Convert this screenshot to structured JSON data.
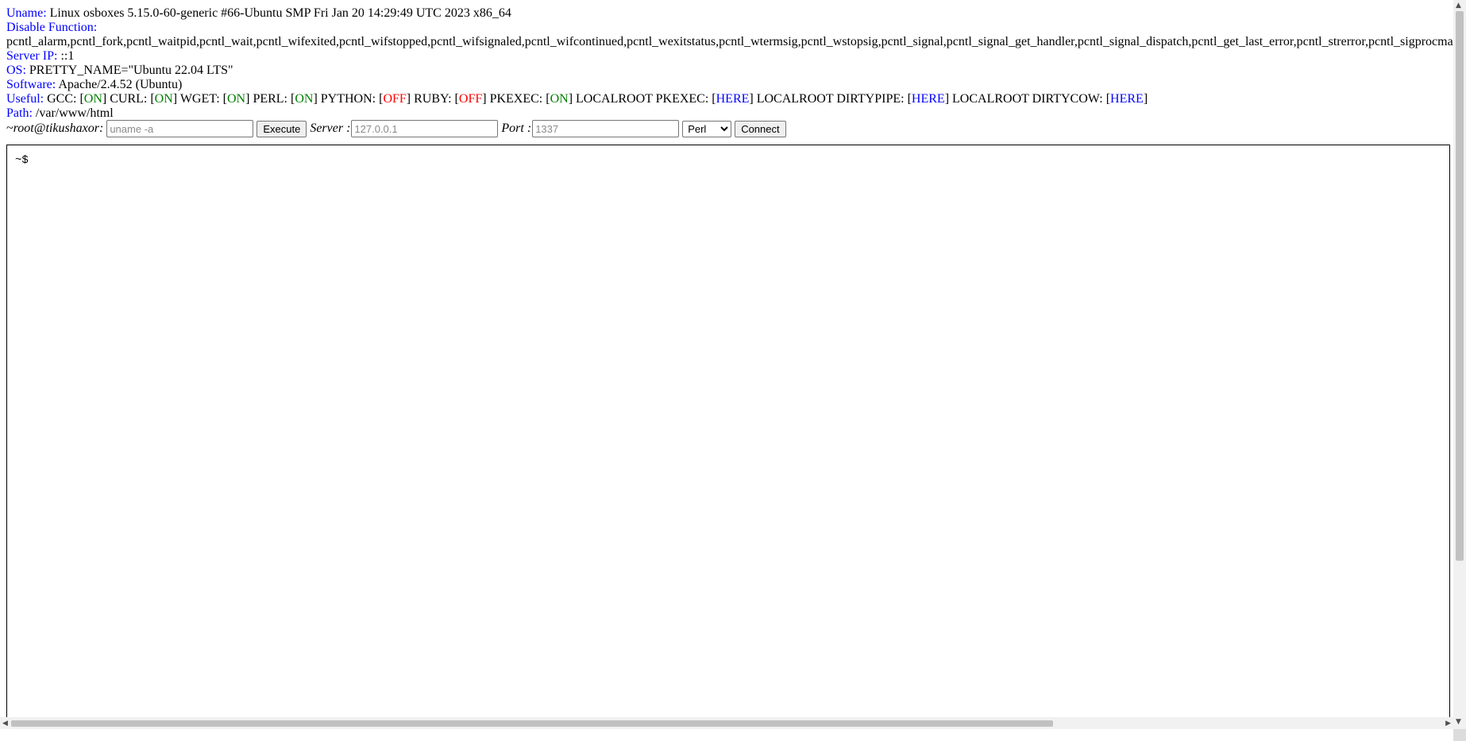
{
  "info": {
    "uname_label": "Uname:",
    "uname_value": " Linux osboxes 5.15.0-60-generic #66-Ubuntu SMP Fri Jan 20 14:29:49 UTC 2023 x86_64",
    "disable_label": "Disable Function:",
    "disable_value": "pcntl_alarm,pcntl_fork,pcntl_waitpid,pcntl_wait,pcntl_wifexited,pcntl_wifstopped,pcntl_wifsignaled,pcntl_wifcontinued,pcntl_wexitstatus,pcntl_wtermsig,pcntl_wstopsig,pcntl_signal,pcntl_signal_get_handler,pcntl_signal_dispatch,pcntl_get_last_error,pcntl_strerror,pcntl_sigprocmask,pcntl_sigwaitinfo,pcntl_sigtimedwait,pcntl_exec,pcntl_getpriority,pcntl_setpriority,pcntl_async_signals,pcntl_unshare,",
    "server_ip_label": "Server IP:",
    "server_ip_value": " ::1",
    "os_label": "OS:",
    "os_value": " PRETTY_NAME=\"Ubuntu 22.04 LTS\"",
    "software_label": "Software:",
    "software_value": " Apache/2.4.52 (Ubuntu)",
    "path_label": "Path:",
    "path_value": " /var/www/html"
  },
  "useful": {
    "label": "Useful:",
    "gcc": " GCC: [",
    "gcc_status": "ON",
    "curl": "] CURL: [",
    "curl_status": "ON",
    "wget": "] WGET: [",
    "wget_status": "ON",
    "perl": "] PERL: [",
    "perl_status": "ON",
    "python": "] PYTHON: [",
    "python_status": "OFF",
    "ruby": "] RUBY: [",
    "ruby_status": "OFF",
    "pkexec": "] PKEXEC: [",
    "pkexec_status": "ON",
    "lr_pkexec": "] LOCALROOT PKEXEC: [",
    "lr_pkexec_link": "HERE",
    "lr_dirtypipe": "] LOCALROOT DIRTYPIPE: [",
    "lr_dirtypipe_link": "HERE",
    "lr_dirtycow": "] LOCALROOT DIRTYCOW: [",
    "lr_dirtycow_link": "HERE",
    "close": "]"
  },
  "controls": {
    "prompt_prefix": "~",
    "prompt_user": "root@tikushaxor:",
    "command_placeholder": "uname -a",
    "execute_label": "Execute",
    "server_label": "Server :",
    "server_placeholder": "127.0.0.1",
    "port_label": "Port :",
    "port_placeholder": "1337",
    "lang_selected": "Perl",
    "connect_label": "Connect"
  },
  "terminal": {
    "prompt": "~$"
  },
  "icons": {
    "scroll_up": "scroll-up-arrow-icon",
    "scroll_down": "scroll-down-arrow-icon",
    "scroll_left": "scroll-left-arrow-icon",
    "scroll_right": "scroll-right-arrow-icon"
  },
  "colors": {
    "label": "#0000ff",
    "on": "#008000",
    "off": "#ff0000",
    "link": "#0000ff"
  }
}
